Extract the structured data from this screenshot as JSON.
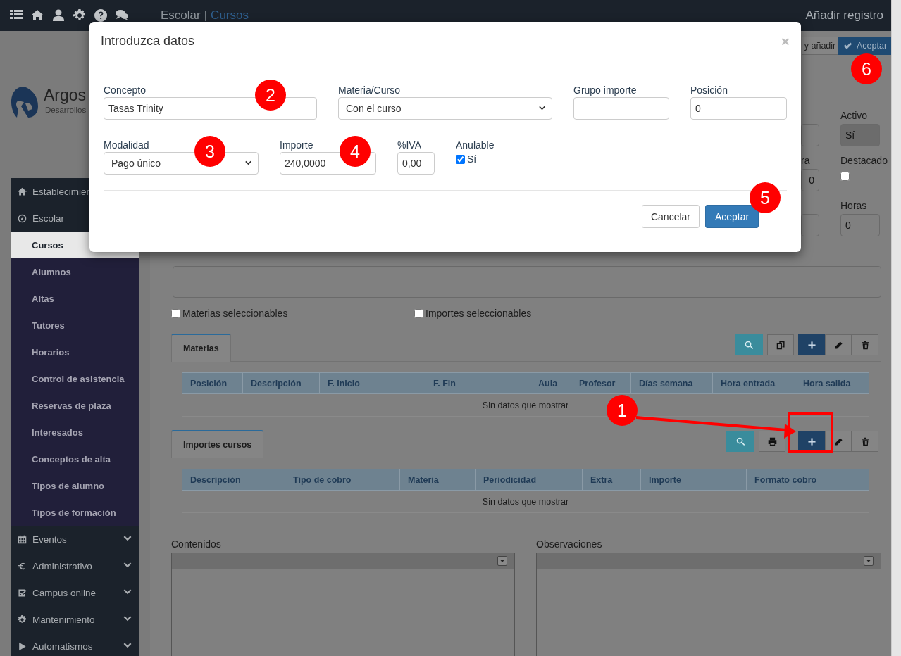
{
  "top_bar": {
    "section": "Escolar",
    "separator": "|",
    "page": "Cursos",
    "title": "Añadir registro"
  },
  "toolbar": [
    {
      "label": "y añadir",
      "kind": "default"
    },
    {
      "label": "Aceptar",
      "kind": "primary"
    }
  ],
  "logo": {
    "name": "Argos",
    "tagline": "Desarrollos"
  },
  "sidebar": {
    "items": [
      {
        "label": "Establecimien",
        "kind": "home",
        "selected": false
      },
      {
        "label": "Escolar",
        "kind": "dashboard",
        "selected": false,
        "expanded": true,
        "children": [
          {
            "label": "Cursos",
            "selected": true
          },
          {
            "label": "Alumnos",
            "selected": false
          },
          {
            "label": "Altas",
            "selected": false
          },
          {
            "label": "Tutores",
            "selected": false
          },
          {
            "label": "Horarios",
            "selected": false
          },
          {
            "label": "Control de asistencia",
            "selected": false
          },
          {
            "label": "Reservas de plaza",
            "selected": false
          },
          {
            "label": "Interesados",
            "selected": false
          },
          {
            "label": "Conceptos de alta",
            "selected": false
          },
          {
            "label": "Tipos de alumno",
            "selected": false
          },
          {
            "label": "Tipos de formación",
            "selected": false
          }
        ]
      },
      {
        "label": "Eventos",
        "kind": "calendar",
        "selected": false,
        "expanded": false
      },
      {
        "label": "Administrativo",
        "kind": "euro",
        "selected": false,
        "expanded": false
      },
      {
        "label": "Campus online",
        "kind": "check",
        "selected": false,
        "expanded": false
      },
      {
        "label": "Mantenimiento",
        "kind": "gear",
        "selected": false,
        "expanded": false
      },
      {
        "label": "Automatismos",
        "kind": "play",
        "selected": false,
        "expanded": false
      }
    ]
  },
  "side_fields": [
    {
      "items": [
        {
          "kind": "field",
          "disabled": false
        },
        {
          "kind": "field",
          "label": "ra",
          "value": "0",
          "disabled": false
        },
        {
          "kind": "field",
          "disabled": false
        }
      ]
    },
    {
      "items": [
        {
          "kind": "field",
          "label": "Activo",
          "value": "Sí",
          "disabled": true
        },
        {
          "kind": "checkbox",
          "label": "Destacado",
          "checked": false
        },
        {
          "kind": "field",
          "label": "Horas",
          "value": "0",
          "disabled": false
        }
      ]
    }
  ],
  "options": [
    {
      "label": "Materias seleccionables",
      "checked": false
    },
    {
      "label": "Importes seleccionables",
      "checked": false
    }
  ],
  "panels": [
    {
      "tab": "Materias",
      "tools": [
        {
          "kind": "search"
        },
        {
          "kind": "copy"
        },
        {
          "kind": "add"
        },
        {
          "kind": "edit"
        },
        {
          "kind": "delete"
        }
      ],
      "table": {
        "columns": [
          "Posición",
          "Descripción",
          "F. Inicio",
          "F. Fin",
          "Aula",
          "Profesor",
          "Días semana",
          "Hora entrada",
          "Hora salida"
        ],
        "empty_text": "Sin datos que mostrar"
      }
    },
    {
      "tab": "Importes cursos",
      "tools": [
        {
          "kind": "search"
        },
        {
          "kind": "print"
        },
        {
          "kind": "add"
        },
        {
          "kind": "edit"
        },
        {
          "kind": "delete"
        }
      ],
      "table": {
        "columns": [
          "Descripción",
          "Tipo de cobro",
          "Materia",
          "Periodicidad",
          "Extra",
          "Importe",
          "Formato cobro"
        ],
        "empty_text": "Sin datos que mostrar"
      }
    }
  ],
  "editors": [
    {
      "label": "Contenidos"
    },
    {
      "label": "Observaciones"
    }
  ],
  "modal": {
    "title": "Introduzca datos",
    "close": "×",
    "rows": [
      [
        {
          "kind": "text",
          "label": "Concepto",
          "value": "Tasas Trinity"
        },
        {
          "kind": "select",
          "label": "Materia/Curso",
          "value": "Con el curso"
        },
        {
          "kind": "text",
          "label": "Grupo importe"
        },
        {
          "kind": "text",
          "label": "Posición",
          "value": "0"
        }
      ],
      [
        {
          "kind": "select",
          "label": "Modalidad",
          "value": "Pago único"
        },
        {
          "kind": "text",
          "label": "Importe",
          "value": "240,0000"
        },
        {
          "kind": "text",
          "label": "%IVA",
          "value": "0,00"
        },
        {
          "kind": "checkbox",
          "label": "Anulable",
          "option": "Sí",
          "checked": true
        }
      ]
    ],
    "buttons": [
      {
        "label": "Cancelar",
        "kind": "default"
      },
      {
        "label": "Aceptar",
        "kind": "primary"
      }
    ]
  },
  "callouts": [
    "1",
    "2",
    "3",
    "4",
    "5",
    "6"
  ]
}
